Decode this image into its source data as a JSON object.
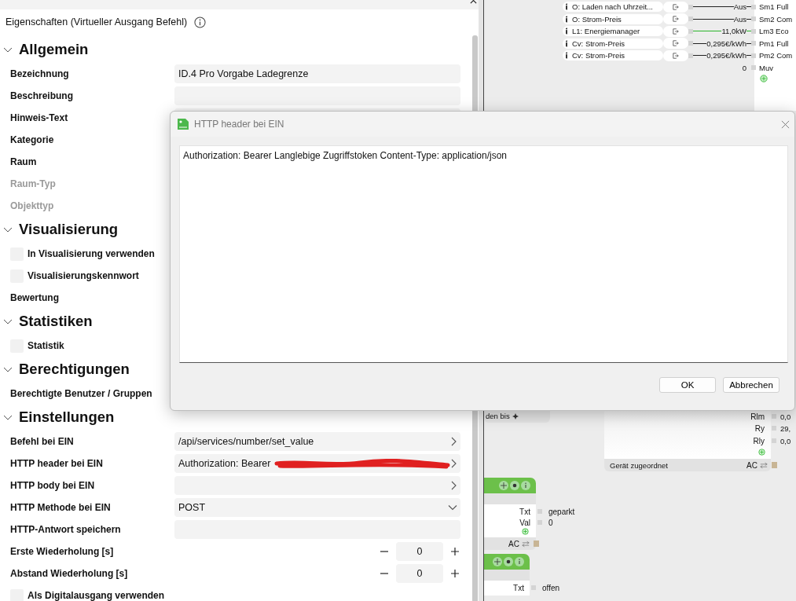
{
  "panel": {
    "title": "Eigenschaften (Virtueller Ausgang Befehl)",
    "sections": [
      {
        "title": "Allgemein",
        "expanded": true,
        "rows": [
          {
            "kind": "text",
            "label": "Bezeichnung",
            "value": "ID.4 Pro Vorgabe Ladegrenze",
            "disabled": false
          },
          {
            "kind": "text",
            "label": "Beschreibung",
            "disabled": false
          },
          {
            "kind": "text",
            "label": "Hinweis-Text",
            "disabled": false
          },
          {
            "kind": "text",
            "label": "Kategorie",
            "disabled": false
          },
          {
            "kind": "text",
            "label": "Raum",
            "disabled": false
          },
          {
            "kind": "label",
            "label": "Raum-Typ",
            "disabled": true
          },
          {
            "kind": "label",
            "label": "Objekttyp",
            "disabled": true
          }
        ]
      },
      {
        "title": "Visualisierung",
        "expanded": true,
        "rows": [
          {
            "kind": "checkbox",
            "label": "In Visualisierung verwenden",
            "checked": false,
            "disabled": false
          },
          {
            "kind": "checkbox",
            "label": "Visualisierungskennwort",
            "checked": false,
            "disabled": false
          },
          {
            "kind": "label",
            "label": "Bewertung",
            "disabled": false
          }
        ]
      },
      {
        "title": "Statistiken",
        "expanded": true,
        "rows": [
          {
            "kind": "checkbox",
            "label": "Statistik",
            "checked": false,
            "disabled": false
          }
        ]
      },
      {
        "title": "Berechtigungen",
        "expanded": true,
        "rows": [
          {
            "kind": "label",
            "label": "Berechtigte Benutzer / Gruppen",
            "disabled": false
          }
        ]
      },
      {
        "title": "Einstellungen",
        "expanded": true,
        "rows": [
          {
            "kind": "link",
            "label": "Befehl bei EIN",
            "value": "/api/services/number/set_value",
            "disabled": false
          },
          {
            "kind": "link",
            "label": "HTTP header bei EIN",
            "value": "Authorization: Bearer",
            "redacted": true,
            "disabled": false
          },
          {
            "kind": "link",
            "label": "HTTP body bei EIN",
            "disabled": false
          },
          {
            "kind": "select",
            "label": "HTTP Methode bei EIN",
            "value": "POST",
            "disabled": false
          },
          {
            "kind": "text",
            "label": "HTTP-Antwort speichern",
            "disabled": false
          },
          {
            "kind": "stepper",
            "label": "Erste Wiederholung [s]",
            "value": "0",
            "disabled": false
          },
          {
            "kind": "stepper",
            "label": "Abstand Wiederholung [s]",
            "value": "0",
            "disabled": false
          },
          {
            "kind": "checkbox",
            "label": "Als Digitalausgang verwenden",
            "checked": false,
            "disabled": false
          }
        ]
      }
    ]
  },
  "canvas": {
    "signals": [
      {
        "label": "O: Laden nach Uhrzeit...",
        "value": "Aus",
        "target": "Sm1 Full",
        "active": false
      },
      {
        "label": "O: Strom-Preis",
        "value": "Aus",
        "target": "Sm2 Com",
        "active": false
      },
      {
        "label": "L1: Energiemanager",
        "value": "11,0kW",
        "target": "Lm3 Eco",
        "active": true
      },
      {
        "label": "Cv: Strom-Preis",
        "value": "0,295€/kWh",
        "target": "Pm1 Full",
        "active": false
      },
      {
        "label": "Cv: Strom-Preis",
        "value": "0,295€/kWh",
        "target": "Pm2 Com",
        "active": false
      }
    ],
    "extra_output": {
      "value": "0",
      "target": "Muv"
    },
    "partial_node": {
      "label": "den bis"
    },
    "device_node": {
      "outputs": [
        {
          "name": "Rlm",
          "value": "0,0"
        },
        {
          "name": "Ry",
          "value": "29,"
        },
        {
          "name": "Rly",
          "value": "0,0"
        }
      ],
      "status": "Gerät zugeordnet",
      "port": "AC"
    },
    "text_nodes": [
      {
        "outputs": [
          {
            "name": "Txt",
            "value": "geparkt"
          },
          {
            "name": "Val",
            "value": "0"
          }
        ],
        "port": "AC"
      },
      {
        "outputs": [
          {
            "name": "Txt",
            "value": "offen"
          }
        ]
      }
    ]
  },
  "dialog": {
    "title": "HTTP header bei EIN",
    "text": "Authorization: Bearer Langlebige Zugriffstoken Content-Type: application/json",
    "buttons": [
      "OK",
      "Abbrechen"
    ]
  }
}
